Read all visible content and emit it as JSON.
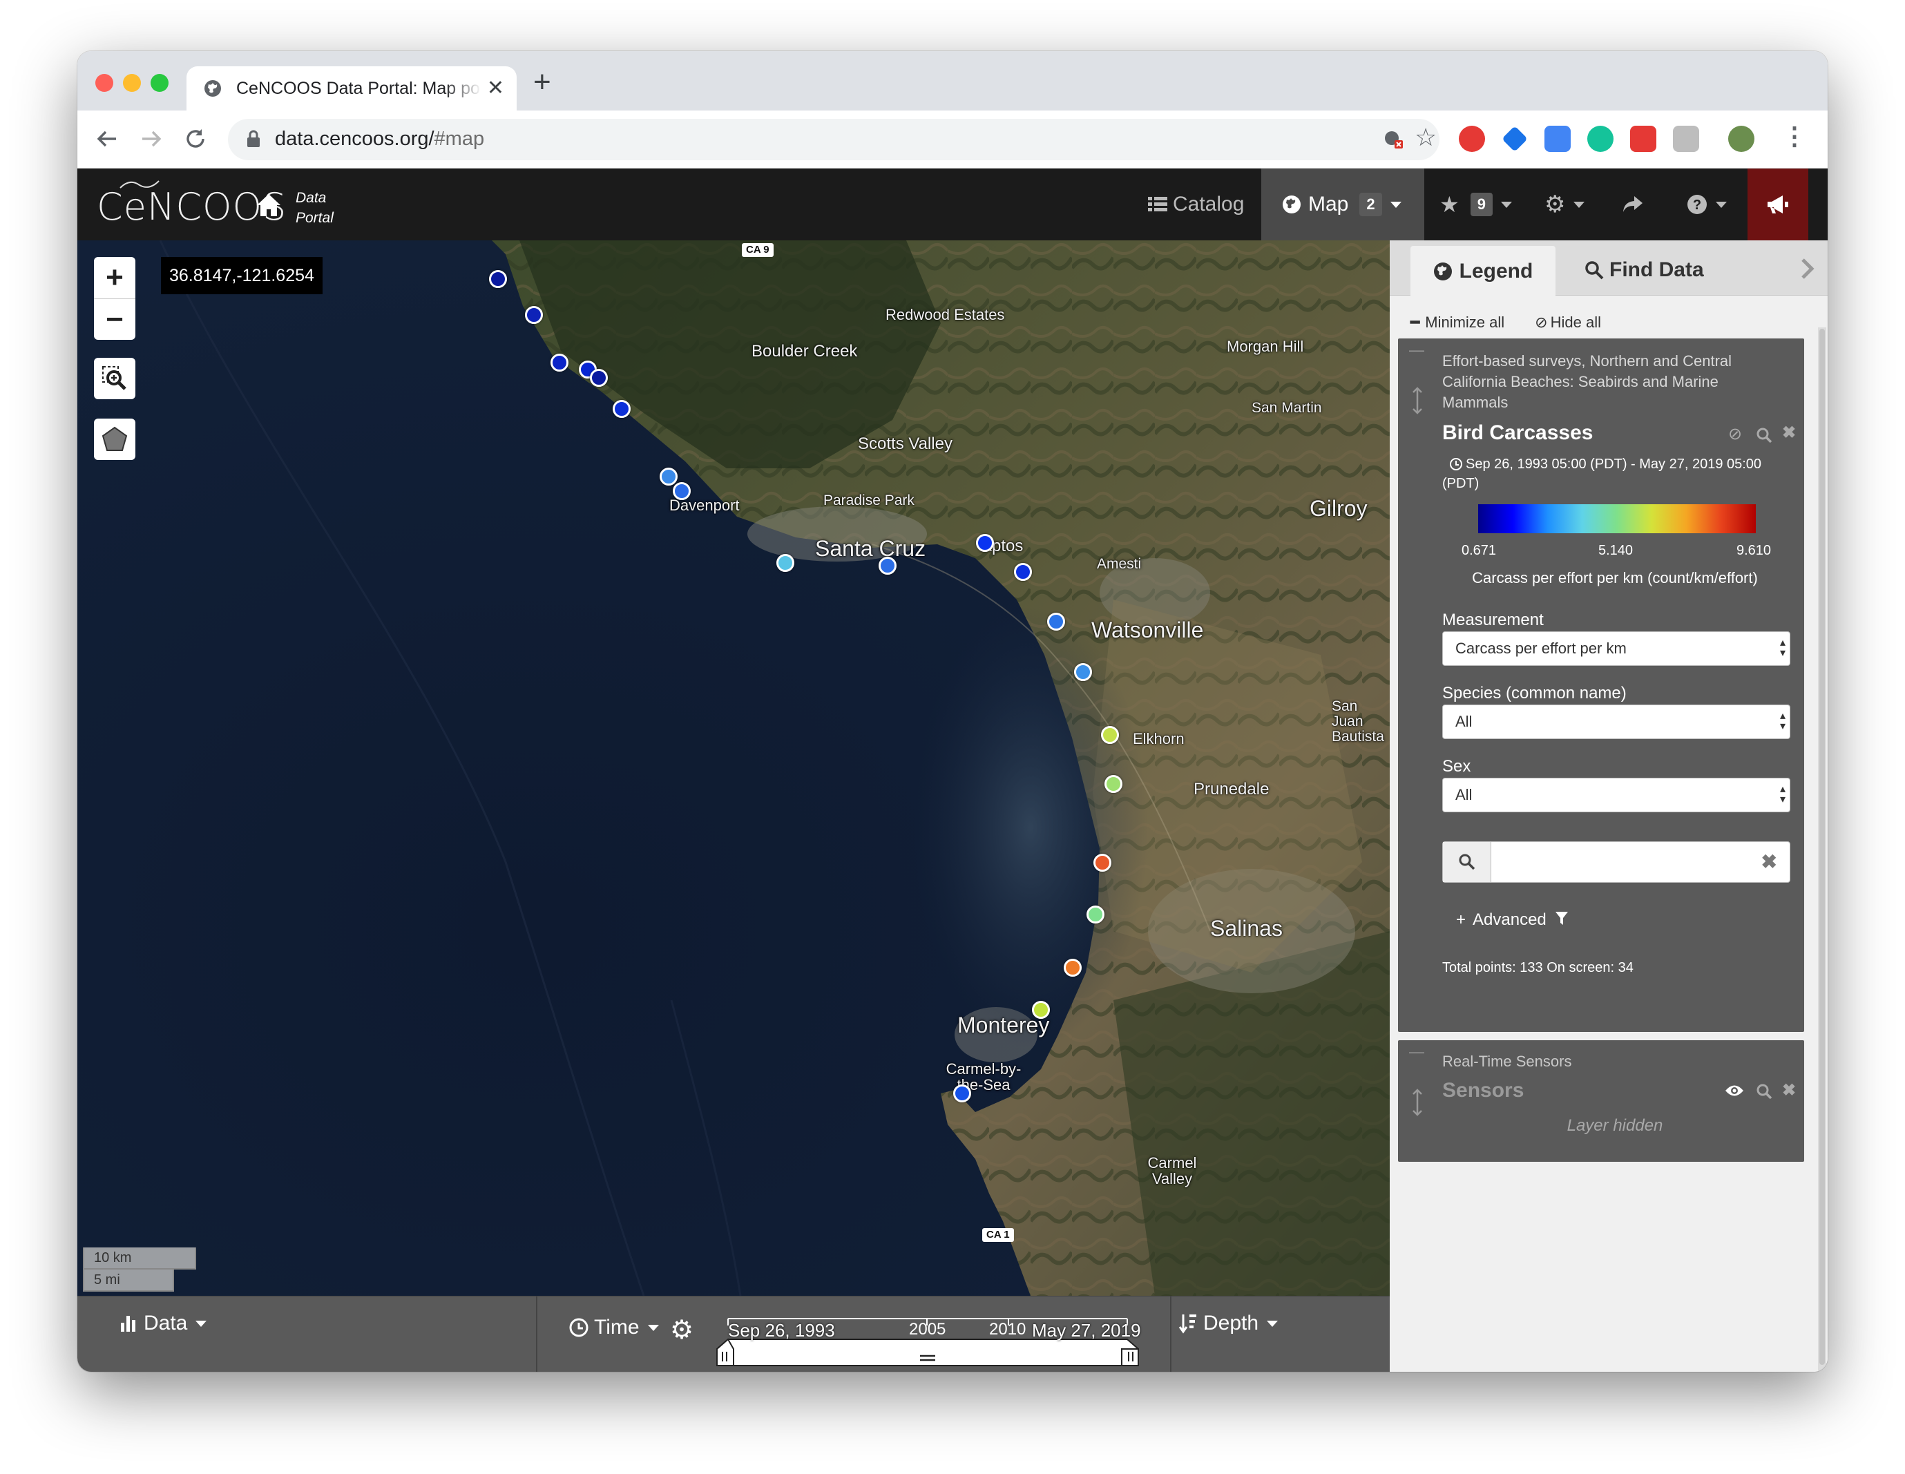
{
  "browser": {
    "tab_title": "CeNCOOS Data Portal: Map portal",
    "tab_close": "✕",
    "new_tab": "+",
    "url_host": "data.cencoos.org/",
    "url_path": "#map"
  },
  "topnav": {
    "logo": "CeNCOOS",
    "portal_line1": "Data",
    "portal_line2": "Portal",
    "catalog_label": "Catalog",
    "map_label": "Map",
    "map_badge": "2",
    "favorites_badge": "9"
  },
  "map": {
    "coords": "36.8147,-121.6254",
    "zoom_in": "+",
    "zoom_out": "−",
    "scale_km": "10 km",
    "scale_mi": "5 mi",
    "highways": [
      "CA 9",
      "CA 1"
    ],
    "places": [
      "Redwood Estates",
      "Boulder Creek",
      "Morgan Hill",
      "San Martin",
      "Scotts Valley",
      "Paradise Park",
      "Davenport",
      "Santa Cruz",
      "Aptos",
      "Amesti",
      "Gilroy",
      "Watsonville",
      "San Juan Bautista",
      "Elkhorn",
      "Prunedale",
      "Salinas",
      "Monterey",
      "Carmel-by-the-Sea",
      "Carmel Valley"
    ]
  },
  "bottom": {
    "data_label": "Data",
    "time_label": "Time",
    "depth_label": "Depth",
    "time_start": "Sep 26, 1993",
    "tick_2005": "2005",
    "tick_2010": "2010",
    "time_end": "May 27, 2019"
  },
  "panel": {
    "tab_legend": "Legend",
    "tab_find": "Find Data",
    "minimize_all": "Minimize all",
    "hide_all": "Hide all",
    "layer1": {
      "group": "Effort-based surveys, Northern and Central California Beaches: Seabirds and Marine Mammals",
      "title": "Bird Carcasses",
      "time_range": "Sep 26, 1993 05:00 (PDT) - May 27, 2019 05:00 (PDT)",
      "scale_min": "0.671",
      "scale_mid": "5.140",
      "scale_max": "9.610",
      "unit": "Carcass per effort per km (count/km/effort)",
      "measurement_label": "Measurement",
      "measurement_value": "Carcass per effort per km",
      "species_label": "Species (common name)",
      "species_value": "All",
      "sex_label": "Sex",
      "sex_value": "All",
      "search_value": "",
      "advanced": "Advanced",
      "totals": "Total points: 133 On screen: 34"
    },
    "layer2": {
      "group": "Real-Time Sensors",
      "title": "Sensors",
      "status": "Layer hidden"
    }
  },
  "colors": {
    "nav_bg": "#1b1b1b",
    "panel_box": "#5a5a5a",
    "alert_button": "#6e1212",
    "colorscale": [
      "#00008b",
      "#0000ff",
      "#1e90ff",
      "#5fd3e8",
      "#7fe08a",
      "#d4e23a",
      "#f5a623",
      "#e8431c",
      "#b00000"
    ]
  }
}
